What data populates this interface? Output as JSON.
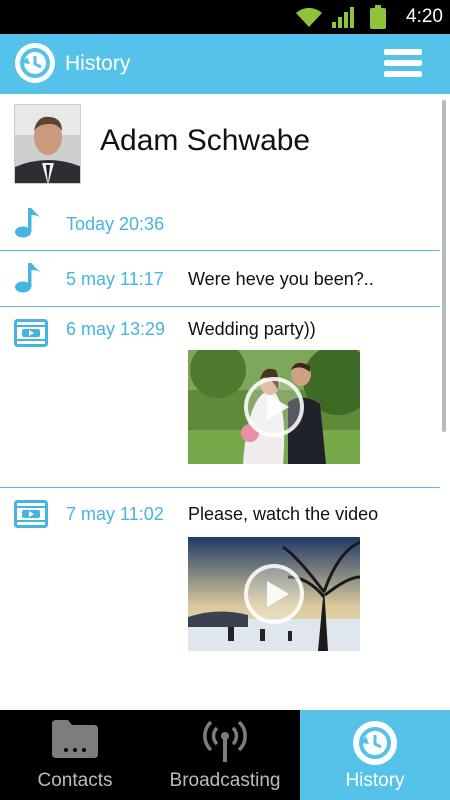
{
  "status_bar": {
    "time": "4:20"
  },
  "action_bar": {
    "title": "History"
  },
  "contact": {
    "name": "Adam Schwabe"
  },
  "messages": [
    {
      "type": "audio",
      "date": "Today 20:36",
      "text": ""
    },
    {
      "type": "audio",
      "date": "5 may 11:17",
      "text": "Were heve you been?.."
    },
    {
      "type": "video",
      "date": "6 may 13:29",
      "text": "Wedding party))"
    },
    {
      "type": "video",
      "date": "7 may 11:02",
      "text": "Please, watch the video"
    }
  ],
  "bottom_nav": {
    "items": [
      {
        "label": "Contacts",
        "active": false
      },
      {
        "label": "Broadcasting",
        "active": false
      },
      {
        "label": "History",
        "active": true
      }
    ]
  },
  "colors": {
    "accent": "#55c2ea",
    "date_text": "#46b4e0"
  }
}
